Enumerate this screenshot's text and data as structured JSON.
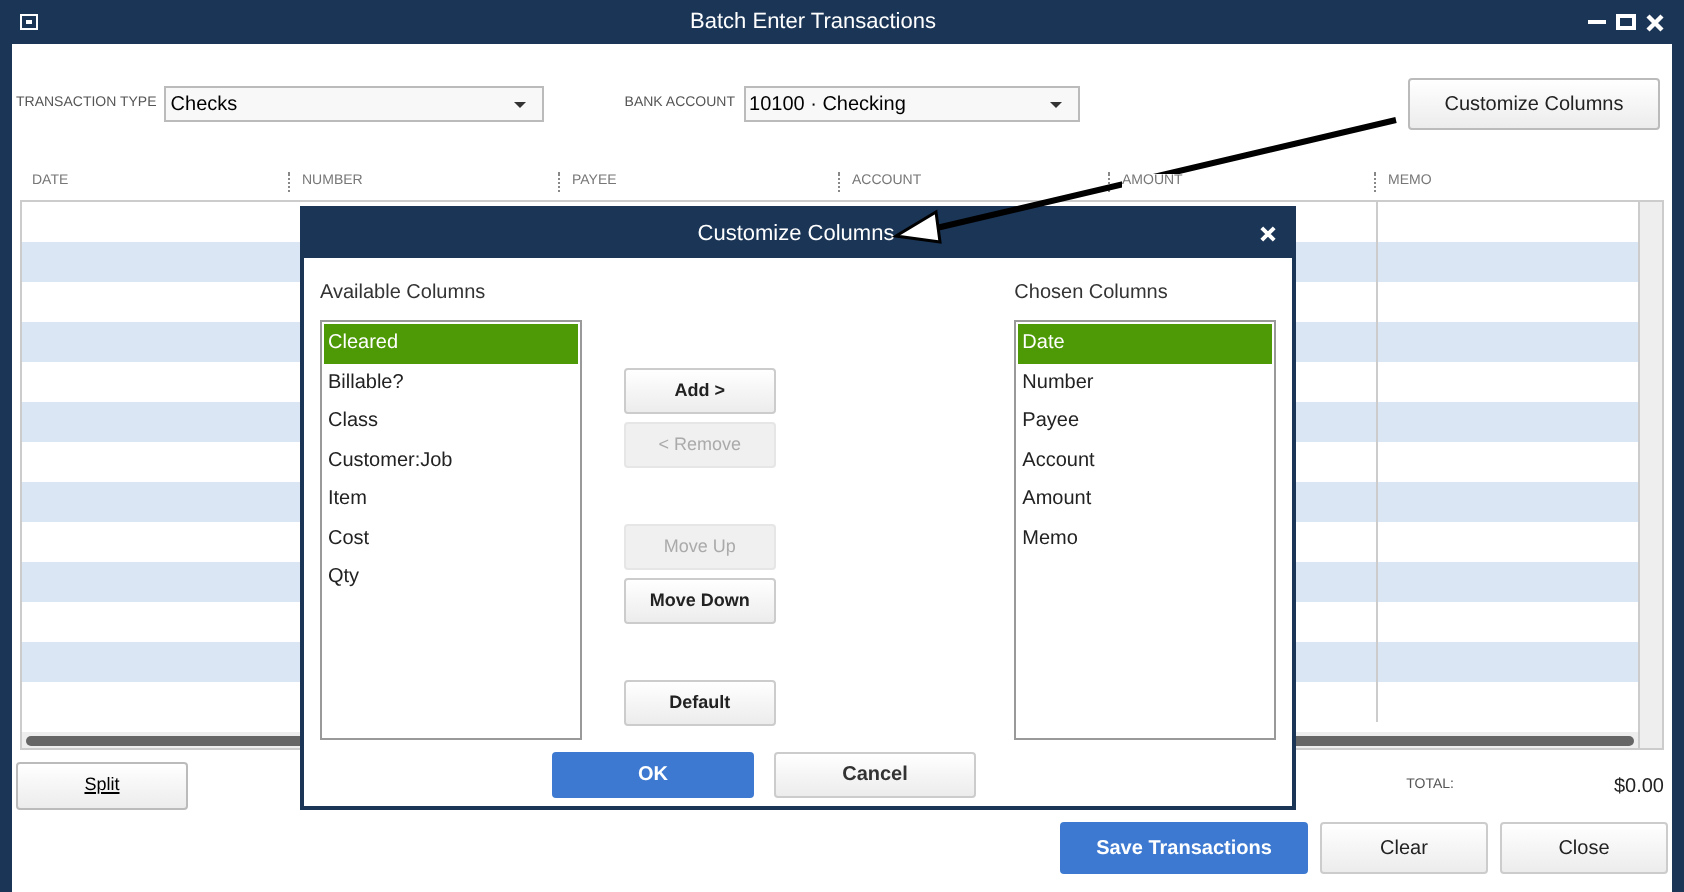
{
  "window": {
    "title": "Batch Enter Transactions"
  },
  "transaction_type": {
    "label": "TRANSACTION TYPE",
    "value": "Checks"
  },
  "bank_account": {
    "label": "BANK ACCOUNT",
    "value": "10100 · Checking"
  },
  "customize_button": "Customize Columns",
  "columns": [
    "DATE",
    "NUMBER",
    "PAYEE",
    "ACCOUNT",
    "AMOUNT",
    "MEMO"
  ],
  "split_button": "Split",
  "total": {
    "label": "TOTAL:",
    "value": "$0.00"
  },
  "buttons": [
    {
      "label": "Save Transactions",
      "primary": true
    },
    {
      "label": "Clear",
      "primary": false
    },
    {
      "label": "Close",
      "primary": false
    }
  ],
  "dialog": {
    "title": "Customize Columns",
    "available": {
      "label": "Available Columns",
      "items": [
        {
          "label": "Cleared",
          "selected": true
        },
        {
          "label": "Billable?",
          "selected": false
        },
        {
          "label": "Class",
          "selected": false
        },
        {
          "label": "Customer:Job",
          "selected": false
        },
        {
          "label": "Item",
          "selected": false
        },
        {
          "label": "Cost",
          "selected": false
        },
        {
          "label": "Qty",
          "selected": false
        }
      ]
    },
    "action_groups": [
      [
        {
          "label": "Add >",
          "disabled": false
        },
        {
          "label": "< Remove",
          "disabled": true
        }
      ],
      [
        {
          "label": "Move Up",
          "disabled": true
        },
        {
          "label": "Move Down",
          "disabled": false
        }
      ],
      [
        {
          "label": "Default",
          "disabled": false
        }
      ]
    ],
    "chosen": {
      "label": "Chosen Columns",
      "items": [
        {
          "label": "Date",
          "selected": true
        },
        {
          "label": "Number",
          "selected": false
        },
        {
          "label": "Payee",
          "selected": false
        },
        {
          "label": "Account",
          "selected": false
        },
        {
          "label": "Amount",
          "selected": false
        },
        {
          "label": "Memo",
          "selected": false
        }
      ]
    },
    "ok": "OK",
    "cancel": "Cancel"
  }
}
